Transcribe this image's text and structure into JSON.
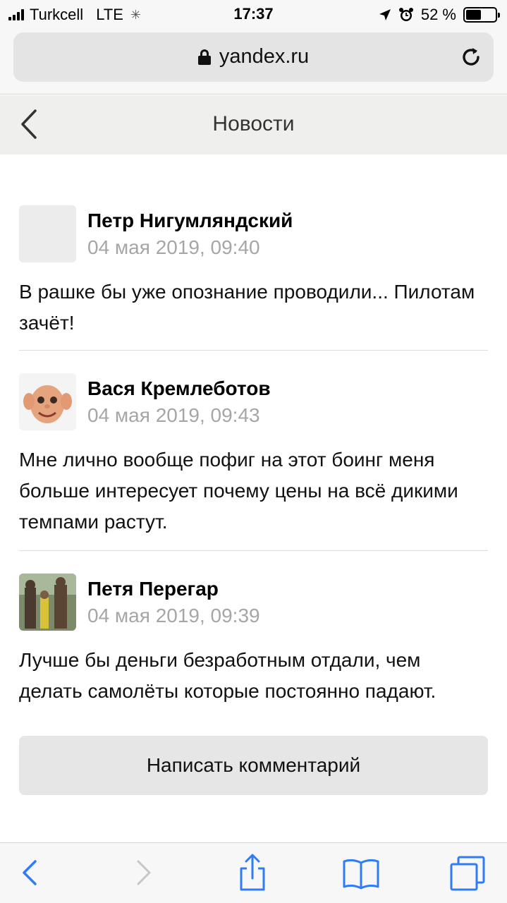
{
  "status_bar": {
    "carrier": "Turkcell",
    "network": "LTE",
    "time": "17:37",
    "battery_percent": "52 %",
    "battery_level": 0.52
  },
  "url_bar": {
    "domain": "yandex.ru"
  },
  "header": {
    "title": "Новости"
  },
  "comments": [
    {
      "author": "Петр Нигумляндский",
      "date": "04 мая 2019, 09:40",
      "text": "В рашке бы уже опознание проводили... Пилотам зачёт!",
      "avatar": "placeholder"
    },
    {
      "author": "Вася Кремлеботов",
      "date": "04 мая 2019, 09:43",
      "text": "Мне лично вообще пофиг на этот боинг меня больше интересует почему цены на всё дикими темпами растут.",
      "avatar": "photo-face"
    },
    {
      "author": "Петя Перегар",
      "date": "04 мая 2019, 09:39",
      "text": "Лучше бы деньги безработным отдали, чем делать самолёты которые постоянно падают.",
      "avatar": "photo-statues"
    }
  ],
  "write_comment_label": "Написать комментарий",
  "toolbar": {
    "icons": [
      "back-icon",
      "forward-icon",
      "share-icon",
      "bookmarks-icon",
      "tabs-icon"
    ]
  },
  "colors": {
    "accent": "#2f7cf6",
    "muted_text": "#a6a6a6"
  }
}
